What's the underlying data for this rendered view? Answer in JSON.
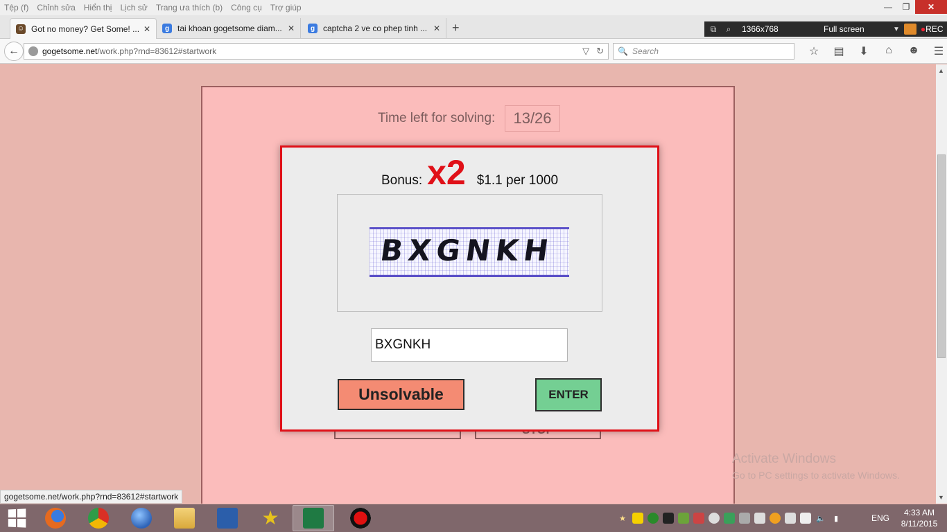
{
  "menu": [
    "Tệp (f)",
    "Chỉnh sửa",
    "Hiển thị",
    "Lịch sử",
    "Trang ưa thích (b)",
    "Công cụ",
    "Trợ giúp"
  ],
  "window_controls": {
    "minimize": "—",
    "restore": "❐",
    "close": "✕"
  },
  "tabs": [
    {
      "title": "Got no money? Get Some! ...",
      "favicon_color": "#6b4a2a",
      "active": true
    },
    {
      "title": "tai khoan gogetsome diam...",
      "favicon_color": "#3b7be0",
      "active": false
    },
    {
      "title": "captcha 2 ve co phep tinh ...",
      "favicon_color": "#3b7be0",
      "active": false
    }
  ],
  "tab_close": "✕",
  "new_tab": "+",
  "recorder": {
    "resolution": "1366x768",
    "mode": "Full screen",
    "rec_label": "REC",
    "rec_dot": "●"
  },
  "nav": {
    "back": "←",
    "url_domain": "gogetsome.net",
    "url_path": "/work.php?rnd=83612#startwork",
    "url_dropdown": "▽",
    "reload": "↻",
    "search_placeholder": "Search",
    "search_icon": "🔍",
    "icons": [
      "☆",
      "▤",
      "⬇",
      "⌂",
      "☻",
      "☰"
    ]
  },
  "work": {
    "timer_label": "Time left for solving:",
    "timer_value": "13/26",
    "bg_button_left": "",
    "bg_button_right": "STOP"
  },
  "captcha_modal": {
    "bonus_label": "Bonus:",
    "bonus_multiplier": "x2",
    "bonus_rate": "$1.1 per 1000",
    "captcha_text": "BXGNKH",
    "answer_value": "BXGNKH",
    "unsolvable_label": "Unsolvable",
    "enter_label": "ENTER"
  },
  "watermark": {
    "line1": "Activate Windows",
    "line2": "Go to PC settings to activate Windows."
  },
  "status_link": "gogetsome.net/work.php?rnd=83612#startwork",
  "scrollbar": {
    "up": "▲",
    "down": "▼"
  },
  "taskbar": {
    "apps": [
      {
        "name": "firefox",
        "color": "#e66a1f"
      },
      {
        "name": "chrome",
        "color": "#2e9c48"
      },
      {
        "name": "globe",
        "color": "#2e63b8"
      },
      {
        "name": "explorer",
        "color": "#e7c05a"
      },
      {
        "name": "word",
        "color": "#2b5eaa"
      },
      {
        "name": "star-app",
        "color": "#e6c21c"
      },
      {
        "name": "excel",
        "color": "#1f7a43"
      },
      {
        "name": "recorder",
        "color": "#d01010"
      }
    ],
    "language": "ENG",
    "time": "4:33 AM",
    "date": "8/11/2015"
  }
}
